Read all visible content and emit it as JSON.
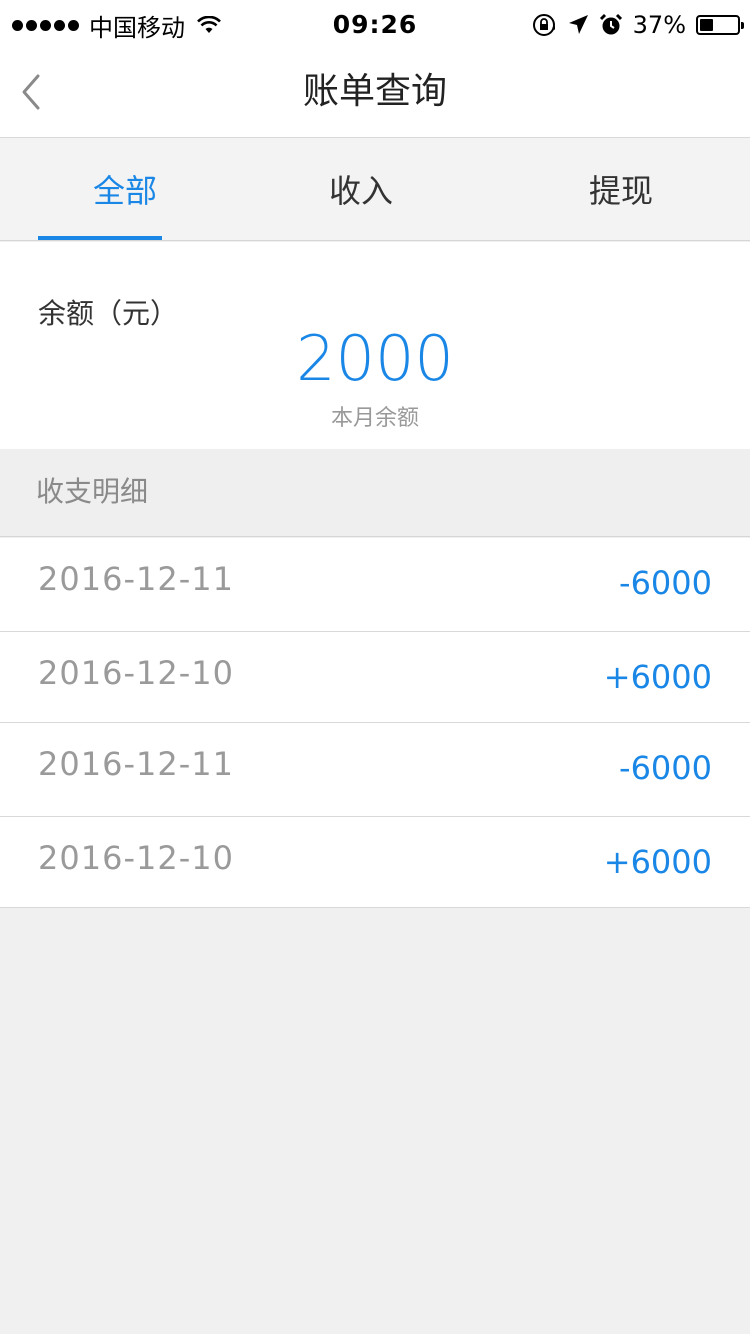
{
  "status_bar": {
    "carrier": "中国移动",
    "time": "09:26",
    "battery_percent": "37%",
    "battery_level": 0.37,
    "icons": [
      "signal-dots-icon",
      "wifi-icon",
      "rotation-lock-icon",
      "location-arrow-icon",
      "alarm-icon",
      "battery-icon"
    ]
  },
  "nav": {
    "title": "账单查询",
    "back_icon": "chevron-left-icon"
  },
  "tabs": [
    {
      "label": "全部",
      "active": true
    },
    {
      "label": "收入",
      "active": false
    },
    {
      "label": "提现",
      "active": false
    }
  ],
  "balance": {
    "label": "余额（元）",
    "amount": "2000",
    "sub_label": "本月余额"
  },
  "section": {
    "title": "收支明细"
  },
  "transactions": [
    {
      "date": "2016-12-11",
      "amount": "-6000"
    },
    {
      "date": "2016-12-10",
      "amount": "+6000"
    },
    {
      "date": "2016-12-11",
      "amount": "-6000"
    },
    {
      "date": "2016-12-10",
      "amount": "+6000"
    }
  ],
  "colors": {
    "accent": "#1a87e6",
    "background": "#f0f0f0"
  }
}
